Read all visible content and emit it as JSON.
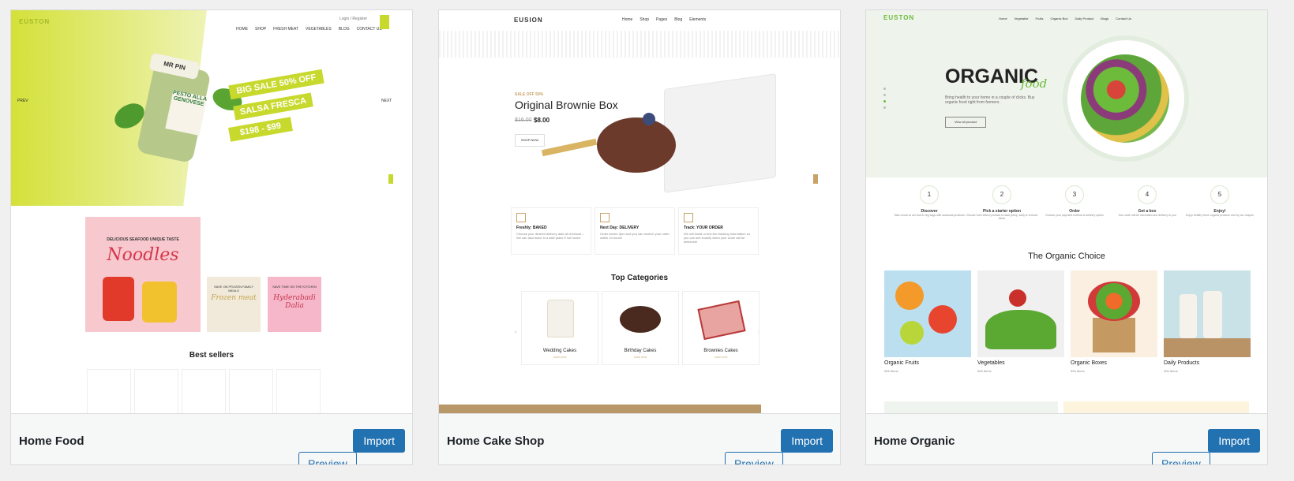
{
  "cards": [
    {
      "title": "Home Food",
      "import_label": "Import",
      "preview_label": "Preview",
      "preview": {
        "logo": "EUSTON",
        "nav": [
          "HOME",
          "SHOP",
          "FRESH MEAT",
          "VEGETABLES",
          "BLOG",
          "CONTACT US"
        ],
        "login": "Login / Register",
        "prev": "PREV",
        "next": "NEXT",
        "jar_brand": "MR PIN",
        "jar_text": "PESTO ALLA GENOVESE",
        "banner_lines": [
          "BIG SALE 50% OFF",
          "SALSA FRESCA",
          "$198 - $99"
        ],
        "promo_main_top": "DELICIOUS SEAFOOD UNIQUE TASTE",
        "promo_main_script": "Noodles",
        "promo_2_top": "SAVE ON FROZEN FAMILY MEALS",
        "promo_2_script": "Frozen meat",
        "promo_3_top": "SAVE TIME ON THE KITCHEN",
        "promo_3_script": "Hyderabadi Dalia",
        "best_sellers": "Best sellers"
      }
    },
    {
      "title": "Home Cake Shop",
      "import_label": "Import",
      "preview_label": "Preview",
      "preview": {
        "logo": "EUSION",
        "nav": [
          "Home",
          "Shop",
          "Pages",
          "Blog",
          "Elements"
        ],
        "sale": "SALE OFF 50%",
        "headline": "Original Brownie Box",
        "old_price": "$16.00",
        "price": "$8.00",
        "shop_now": "SHOP NOW",
        "features": [
          {
            "title": "Freshly: BAKED",
            "text": "Choose your desired delivery date at checkout – We can also leave in a safe place if not home!"
          },
          {
            "title": "Next Day: DELIVERY",
            "text": "Order before 3pm and you can receive your order within 24 hours!"
          },
          {
            "title": "Track: YOUR ORDER",
            "text": "We will email or text live tracking information so you can see exactly when your order will be delivered!"
          }
        ],
        "categories_heading": "Top Categories",
        "categories": [
          "Wedding Cakes",
          "Birthday Cakes",
          "Brownies Cakes"
        ],
        "category_link": "SHOP NOW"
      }
    },
    {
      "title": "Home Organic",
      "import_label": "Import",
      "preview_label": "Preview",
      "preview": {
        "logo": "EUSTON",
        "nav": [
          "Home",
          "Vegetable",
          "Fruits",
          "Organic Box",
          "Daily Product",
          "Blogs",
          "Contact Us"
        ],
        "hero_title": "ORGANIC",
        "hero_script": "food",
        "hero_text": "Bring health to your home in a couple of clicks. Buy organic food right from farmers.",
        "hero_button": "View all product",
        "steps": [
          {
            "num": "1",
            "title": "Discover",
            "text": "Take a look at our fruit & veg bags with seasonal products"
          },
          {
            "num": "2",
            "title": "Pick a starter option",
            "text": "Choose from select produce to start (keep, add) or remove items"
          },
          {
            "num": "3",
            "title": "Order",
            "text": "Choose your payment method & delivery option"
          },
          {
            "num": "4",
            "title": "Get a box",
            "text": "Your order will be harvested and delivery to you"
          },
          {
            "num": "5",
            "title": "Enjoy!",
            "text": "Enjoy healthy fresh organic produce and try our recipes"
          }
        ],
        "choice_heading": "The Organic Choice",
        "products": [
          {
            "name": "Organic Fruits",
            "count": "306 Items"
          },
          {
            "name": "Vegetables",
            "count": "306 Items"
          },
          {
            "name": "Organic Boxes",
            "count": "306 Items"
          },
          {
            "name": "Daily Products",
            "count": "306 Items"
          }
        ]
      }
    }
  ],
  "colors": {
    "primary": "#2271b1",
    "page_bg": "#f0f0f1",
    "lime": "#c8d92e",
    "organic_green": "#6dbb3b",
    "cake_gold": "#c8a269"
  }
}
